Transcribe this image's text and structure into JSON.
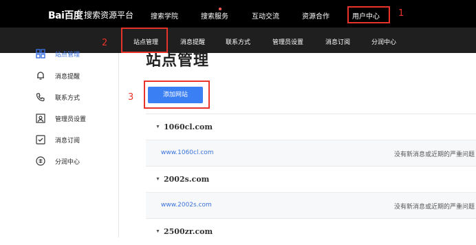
{
  "header": {
    "logo_text": "Bai百度",
    "platform": "搜索资源平台",
    "nav": [
      "搜索学院",
      "搜索服务",
      "互动交流",
      "资源合作",
      "用户中心"
    ],
    "notification_color": "#ff5a5a"
  },
  "subnav": [
    "站点管理",
    "消息提醒",
    "联系方式",
    "管理员设置",
    "消息订阅",
    "分润中心"
  ],
  "sidebar": {
    "items": [
      {
        "label": "站点管理",
        "icon": "grid-icon"
      },
      {
        "label": "消息提醒",
        "icon": "bell-icon"
      },
      {
        "label": "联系方式",
        "icon": "phone-icon"
      },
      {
        "label": "管理员设置",
        "icon": "admin-user-icon"
      },
      {
        "label": "消息订阅",
        "icon": "subscribe-check-icon"
      },
      {
        "label": "分润中心",
        "icon": "coin-icon"
      }
    ]
  },
  "main": {
    "title": "站点管理",
    "add_button": "添加网站",
    "sites": [
      {
        "name": "1060cl.com",
        "url": "www.1060cl.com",
        "status": "没有新消息或近期的严重问题"
      },
      {
        "name": "2002s.com",
        "url": "www.2002s.com",
        "status": "没有新消息或近期的严重问题"
      },
      {
        "name": "2500zr.com"
      }
    ]
  },
  "annotations": [
    "1",
    "2",
    "3"
  ],
  "colors": {
    "accent": "#3b7ff5",
    "annotation": "#e8332a",
    "topbar": "#000000"
  }
}
